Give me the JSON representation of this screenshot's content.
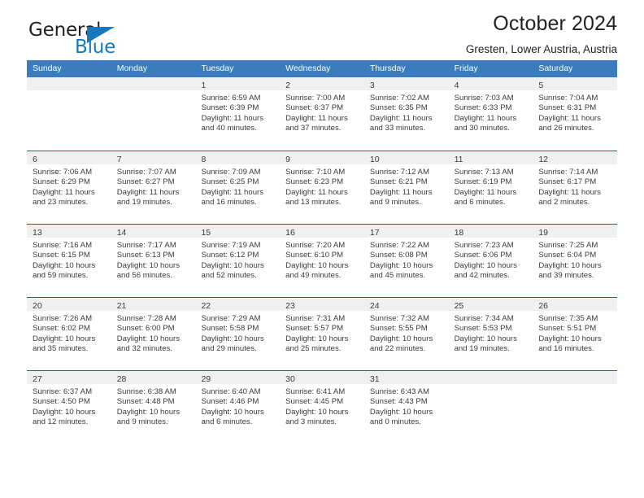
{
  "logo": {
    "word1": "General",
    "word2": "Blue",
    "triangle_color": "#1878be"
  },
  "header": {
    "title": "October 2024",
    "location": "Gresten, Lower Austria, Austria"
  },
  "theme": {
    "header_bar": "#3a7cbe",
    "row_rule": "#1f5fa0",
    "day_band": "#f0f0f0",
    "text": "#3a3a3a"
  },
  "weekdays": [
    "Sunday",
    "Monday",
    "Tuesday",
    "Wednesday",
    "Thursday",
    "Friday",
    "Saturday"
  ],
  "weeks": [
    [
      {
        "day": "",
        "lines": []
      },
      {
        "day": "",
        "lines": []
      },
      {
        "day": "1",
        "lines": [
          "Sunrise: 6:59 AM",
          "Sunset: 6:39 PM",
          "Daylight: 11 hours",
          "and 40 minutes."
        ]
      },
      {
        "day": "2",
        "lines": [
          "Sunrise: 7:00 AM",
          "Sunset: 6:37 PM",
          "Daylight: 11 hours",
          "and 37 minutes."
        ]
      },
      {
        "day": "3",
        "lines": [
          "Sunrise: 7:02 AM",
          "Sunset: 6:35 PM",
          "Daylight: 11 hours",
          "and 33 minutes."
        ]
      },
      {
        "day": "4",
        "lines": [
          "Sunrise: 7:03 AM",
          "Sunset: 6:33 PM",
          "Daylight: 11 hours",
          "and 30 minutes."
        ]
      },
      {
        "day": "5",
        "lines": [
          "Sunrise: 7:04 AM",
          "Sunset: 6:31 PM",
          "Daylight: 11 hours",
          "and 26 minutes."
        ]
      }
    ],
    [
      {
        "day": "6",
        "lines": [
          "Sunrise: 7:06 AM",
          "Sunset: 6:29 PM",
          "Daylight: 11 hours",
          "and 23 minutes."
        ]
      },
      {
        "day": "7",
        "lines": [
          "Sunrise: 7:07 AM",
          "Sunset: 6:27 PM",
          "Daylight: 11 hours",
          "and 19 minutes."
        ]
      },
      {
        "day": "8",
        "lines": [
          "Sunrise: 7:09 AM",
          "Sunset: 6:25 PM",
          "Daylight: 11 hours",
          "and 16 minutes."
        ]
      },
      {
        "day": "9",
        "lines": [
          "Sunrise: 7:10 AM",
          "Sunset: 6:23 PM",
          "Daylight: 11 hours",
          "and 13 minutes."
        ]
      },
      {
        "day": "10",
        "lines": [
          "Sunrise: 7:12 AM",
          "Sunset: 6:21 PM",
          "Daylight: 11 hours",
          "and 9 minutes."
        ]
      },
      {
        "day": "11",
        "lines": [
          "Sunrise: 7:13 AM",
          "Sunset: 6:19 PM",
          "Daylight: 11 hours",
          "and 6 minutes."
        ]
      },
      {
        "day": "12",
        "lines": [
          "Sunrise: 7:14 AM",
          "Sunset: 6:17 PM",
          "Daylight: 11 hours",
          "and 2 minutes."
        ]
      }
    ],
    [
      {
        "day": "13",
        "lines": [
          "Sunrise: 7:16 AM",
          "Sunset: 6:15 PM",
          "Daylight: 10 hours",
          "and 59 minutes."
        ]
      },
      {
        "day": "14",
        "lines": [
          "Sunrise: 7:17 AM",
          "Sunset: 6:13 PM",
          "Daylight: 10 hours",
          "and 56 minutes."
        ]
      },
      {
        "day": "15",
        "lines": [
          "Sunrise: 7:19 AM",
          "Sunset: 6:12 PM",
          "Daylight: 10 hours",
          "and 52 minutes."
        ]
      },
      {
        "day": "16",
        "lines": [
          "Sunrise: 7:20 AM",
          "Sunset: 6:10 PM",
          "Daylight: 10 hours",
          "and 49 minutes."
        ]
      },
      {
        "day": "17",
        "lines": [
          "Sunrise: 7:22 AM",
          "Sunset: 6:08 PM",
          "Daylight: 10 hours",
          "and 45 minutes."
        ]
      },
      {
        "day": "18",
        "lines": [
          "Sunrise: 7:23 AM",
          "Sunset: 6:06 PM",
          "Daylight: 10 hours",
          "and 42 minutes."
        ]
      },
      {
        "day": "19",
        "lines": [
          "Sunrise: 7:25 AM",
          "Sunset: 6:04 PM",
          "Daylight: 10 hours",
          "and 39 minutes."
        ]
      }
    ],
    [
      {
        "day": "20",
        "lines": [
          "Sunrise: 7:26 AM",
          "Sunset: 6:02 PM",
          "Daylight: 10 hours",
          "and 35 minutes."
        ]
      },
      {
        "day": "21",
        "lines": [
          "Sunrise: 7:28 AM",
          "Sunset: 6:00 PM",
          "Daylight: 10 hours",
          "and 32 minutes."
        ]
      },
      {
        "day": "22",
        "lines": [
          "Sunrise: 7:29 AM",
          "Sunset: 5:58 PM",
          "Daylight: 10 hours",
          "and 29 minutes."
        ]
      },
      {
        "day": "23",
        "lines": [
          "Sunrise: 7:31 AM",
          "Sunset: 5:57 PM",
          "Daylight: 10 hours",
          "and 25 minutes."
        ]
      },
      {
        "day": "24",
        "lines": [
          "Sunrise: 7:32 AM",
          "Sunset: 5:55 PM",
          "Daylight: 10 hours",
          "and 22 minutes."
        ]
      },
      {
        "day": "25",
        "lines": [
          "Sunrise: 7:34 AM",
          "Sunset: 5:53 PM",
          "Daylight: 10 hours",
          "and 19 minutes."
        ]
      },
      {
        "day": "26",
        "lines": [
          "Sunrise: 7:35 AM",
          "Sunset: 5:51 PM",
          "Daylight: 10 hours",
          "and 16 minutes."
        ]
      }
    ],
    [
      {
        "day": "27",
        "lines": [
          "Sunrise: 6:37 AM",
          "Sunset: 4:50 PM",
          "Daylight: 10 hours",
          "and 12 minutes."
        ]
      },
      {
        "day": "28",
        "lines": [
          "Sunrise: 6:38 AM",
          "Sunset: 4:48 PM",
          "Daylight: 10 hours",
          "and 9 minutes."
        ]
      },
      {
        "day": "29",
        "lines": [
          "Sunrise: 6:40 AM",
          "Sunset: 4:46 PM",
          "Daylight: 10 hours",
          "and 6 minutes."
        ]
      },
      {
        "day": "30",
        "lines": [
          "Sunrise: 6:41 AM",
          "Sunset: 4:45 PM",
          "Daylight: 10 hours",
          "and 3 minutes."
        ]
      },
      {
        "day": "31",
        "lines": [
          "Sunrise: 6:43 AM",
          "Sunset: 4:43 PM",
          "Daylight: 10 hours",
          "and 0 minutes."
        ]
      },
      {
        "day": "",
        "lines": []
      },
      {
        "day": "",
        "lines": []
      }
    ]
  ]
}
